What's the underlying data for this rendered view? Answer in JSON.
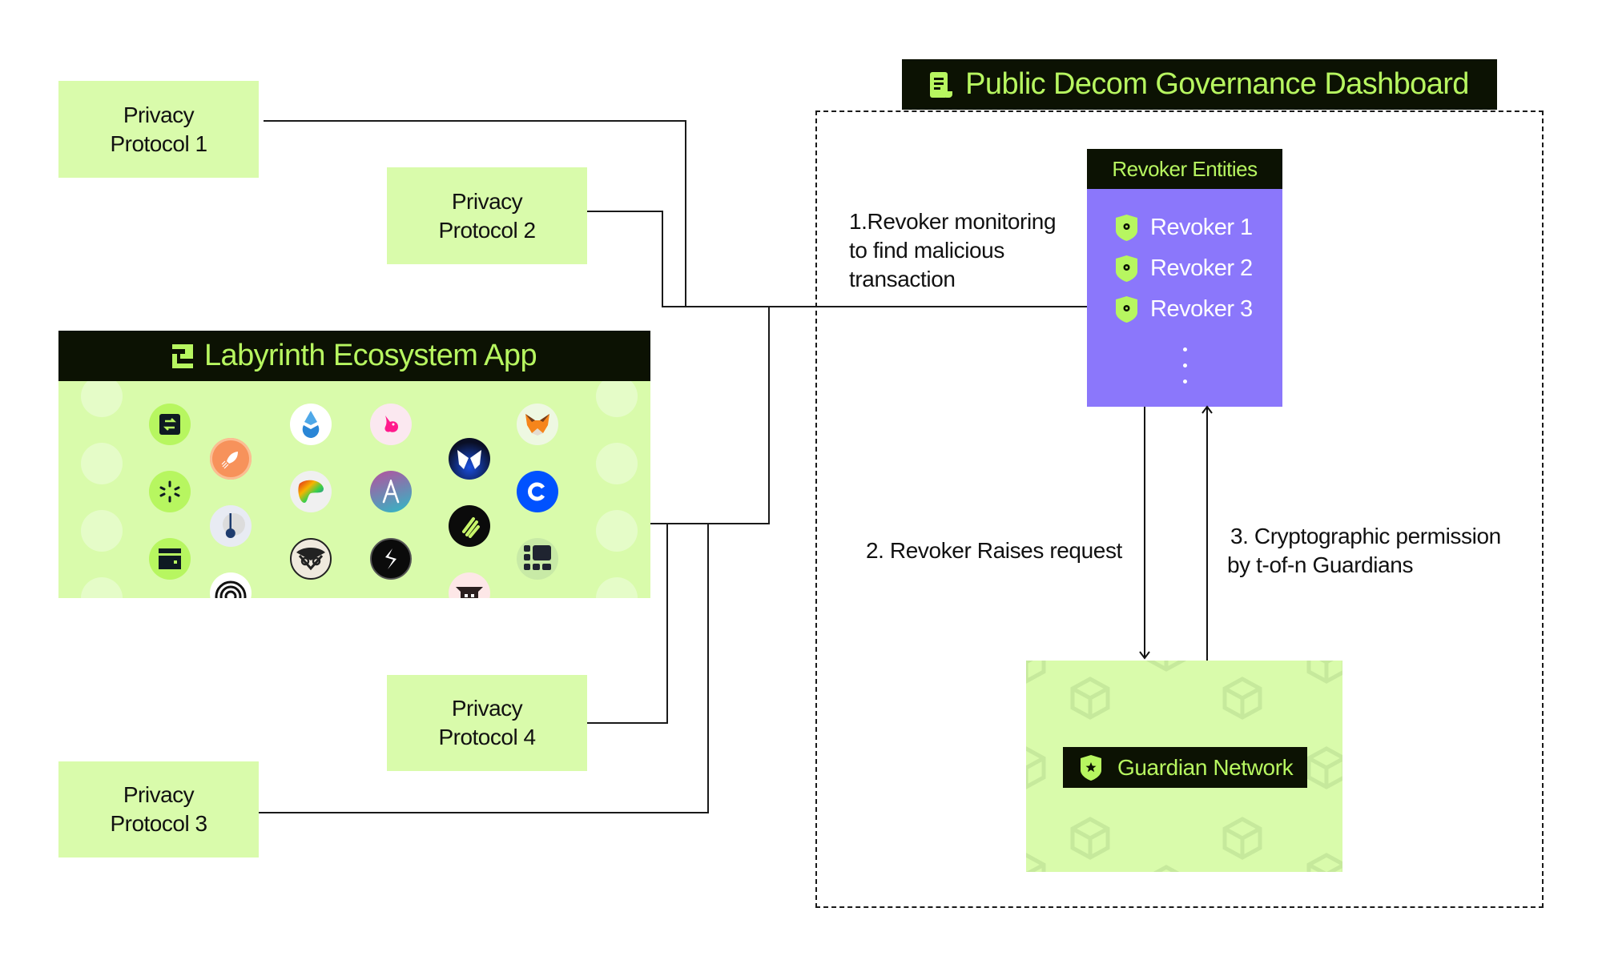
{
  "privacy_protocols": [
    {
      "line1": "Privacy",
      "line2": "Protocol 1"
    },
    {
      "line1": "Privacy",
      "line2": "Protocol 2"
    },
    {
      "line1": "Privacy",
      "line2": "Protocol 3"
    },
    {
      "line1": "Privacy",
      "line2": "Protocol 4"
    }
  ],
  "labyrinth": {
    "title": "Labyrinth Ecosystem App",
    "logo_icon": "labyrinth-logo-icon",
    "app_icons": [
      "swap-icon",
      "1inch-icon",
      "rocket-icon",
      "lido-icon",
      "uniswap-icon",
      "curve-icon",
      "aave-icon",
      "sparkle-icon",
      "pendulum-icon",
      "wallet-icon",
      "gnosis-owl-icon",
      "stack-icon",
      "spiral-icon",
      "link-icon",
      "butterfly-icon",
      "ethena-icon",
      "bot-icon",
      "metamask-icon",
      "coinbase-icon",
      "grid-icon"
    ]
  },
  "dashboard": {
    "title": "Public Decom Governance Dashboard",
    "icon": "document-icon"
  },
  "revoker_entities": {
    "title": "Revoker Entities",
    "items": [
      "Revoker 1",
      "Revoker 2",
      "Revoker 3"
    ],
    "more_icon": "vertical-ellipsis-icon"
  },
  "steps": {
    "step1": [
      "1.Revoker monitoring",
      "to find malicious",
      "transaction"
    ],
    "step2": "2. Revoker Raises request",
    "step3": [
      "3. Cryptographic permission",
      "by t-of-n Guardians"
    ]
  },
  "guardian": {
    "title": "Guardian Network",
    "icon": "shield-star-icon"
  },
  "colors": {
    "lime_fill": "#d9fbab",
    "dark_header": "#0c1203",
    "accent_text": "#b7f660",
    "revoker_purple": "#8b77fb"
  }
}
